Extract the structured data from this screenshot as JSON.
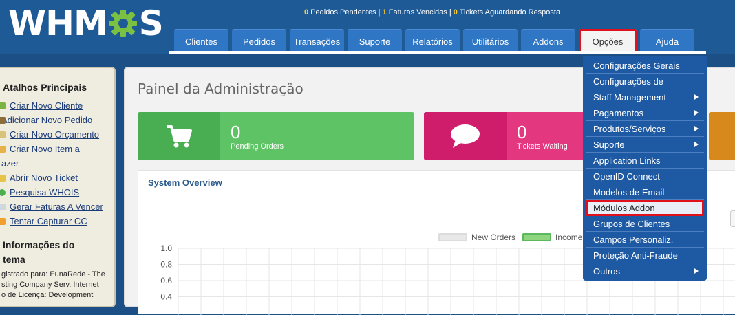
{
  "logo": {
    "text_left": "WHM",
    "text_right": "S"
  },
  "stats": {
    "pending_orders_count": "0",
    "pending_orders_label": "Pedidos Pendentes",
    "overdue_invoices_count": "1",
    "overdue_invoices_label": "Faturas Vencidas",
    "tickets_count": "0",
    "tickets_label": "Tickets Aguardando Resposta",
    "separator": "|"
  },
  "nav": {
    "tabs": [
      {
        "label": "Clientes"
      },
      {
        "label": "Pedidos"
      },
      {
        "label": "Transações"
      },
      {
        "label": "Suporte"
      },
      {
        "label": "Relatórios"
      },
      {
        "label": "Utilitários"
      },
      {
        "label": "Addons"
      },
      {
        "label": "Opções"
      },
      {
        "label": "Ajuda"
      }
    ],
    "active": "Opções"
  },
  "sidebar": {
    "shortcuts_title": "Atalhos Principais",
    "shortcuts": [
      {
        "label": "Criar Novo Cliente"
      },
      {
        "label": "Adicionar Novo Pedido"
      },
      {
        "label": "Criar Novo Orçamento"
      },
      {
        "label": "Criar Novo Item a"
      },
      {
        "label": "azer"
      },
      {
        "label": "Abrir Novo Ticket"
      },
      {
        "label": "Pesquisa WHOIS"
      },
      {
        "label": "Gerar Faturas A Vencer"
      },
      {
        "label": "Tentar Capturar CC"
      }
    ],
    "info_title_1": "Informações do",
    "info_title_2": "tema",
    "info_lines": [
      "gistrado para: EunaRede - The",
      "sting Company Serv. Internet",
      "o de Licença: Development"
    ]
  },
  "main": {
    "title": "Painel da Administração",
    "cards": [
      {
        "value": "0",
        "label": "Pending Orders"
      },
      {
        "value": "0",
        "label": "Tickets Waiting"
      }
    ],
    "overview_title": "System Overview",
    "legend": [
      {
        "label": "New Orders"
      },
      {
        "label": "Income"
      }
    ]
  },
  "chart_data": {
    "type": "line",
    "series": [
      {
        "name": "New Orders",
        "values": []
      },
      {
        "name": "Income",
        "values": []
      }
    ],
    "y_ticks": [
      "1.0",
      "0.8",
      "0.6",
      "0.4"
    ],
    "ylim": [
      0,
      1
    ],
    "grid": true,
    "legend_position": "top"
  },
  "dropdown": {
    "items": [
      {
        "label": "Configurações Gerais",
        "submenu": false
      },
      {
        "label": "Configurações de",
        "submenu": false
      },
      {
        "label": "Staff Management",
        "submenu": true
      },
      {
        "label": "Pagamentos",
        "submenu": true
      },
      {
        "label": "Produtos/Serviços",
        "submenu": true
      },
      {
        "label": "Suporte",
        "submenu": true
      },
      {
        "label": "Application Links",
        "submenu": false
      },
      {
        "label": "OpenID Connect",
        "submenu": false
      },
      {
        "label": "Modelos de Email",
        "submenu": false
      },
      {
        "label": "Módulos Addon",
        "submenu": false,
        "highlighted": true
      },
      {
        "label": "Grupos de Clientes",
        "submenu": false
      },
      {
        "label": "Campos Personaliz.",
        "submenu": false
      },
      {
        "label": "Proteção Anti-Fraude",
        "submenu": false
      },
      {
        "label": "Outros",
        "submenu": true
      }
    ]
  },
  "colors": {
    "header_bg": "#1e5a96",
    "tab_bg": "#2f76c4",
    "highlight_border": "#e0101c",
    "green": "#5ec364",
    "pink": "#e33880",
    "orange": "#d78a1b",
    "stat_number": "#ffcc33"
  }
}
